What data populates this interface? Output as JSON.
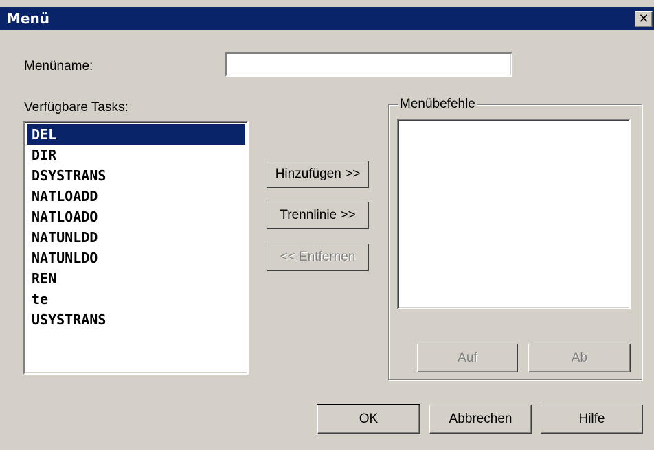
{
  "window": {
    "title": "Menü",
    "close_symbol": "✕"
  },
  "form": {
    "menuname_label": "Menüname:",
    "menuname_value": "",
    "available_tasks_label": "Verfügbare Tasks:",
    "menu_commands_label": "Menübefehle"
  },
  "tasks": {
    "items": [
      "DEL",
      "DIR",
      "DSYSTRANS",
      "NATLOADD",
      "NATLOADO",
      "NATUNLDD",
      "NATUNLDO",
      "REN",
      "te",
      "USYSTRANS"
    ],
    "selected": "DEL"
  },
  "menu_commands": {
    "items": []
  },
  "buttons": {
    "add": "Hinzufügen >>",
    "separator": "Trennlinie >>",
    "remove": "<< Entfernen",
    "up": "Auf",
    "down": "Ab",
    "ok": "OK",
    "cancel": "Abbrechen",
    "help": "Hilfe"
  }
}
